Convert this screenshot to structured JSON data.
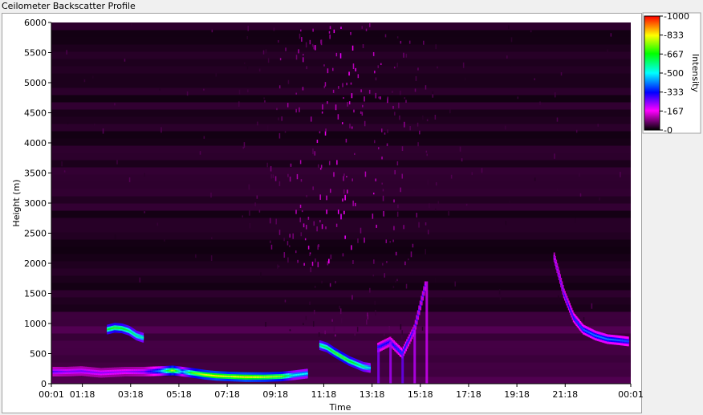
{
  "window": {
    "title": "Ceilometer Backscatter Profile"
  },
  "chart_data": {
    "type": "heatmap",
    "title": "",
    "xlabel": "Time",
    "ylabel": "Height (m)",
    "x_ticks": [
      "00:01",
      "01:18",
      "03:18",
      "05:18",
      "07:18",
      "09:18",
      "11:18",
      "13:18",
      "15:18",
      "17:18",
      "19:18",
      "21:18",
      "00:01"
    ],
    "x_tick_hours": [
      0.0,
      1.283,
      3.283,
      5.283,
      7.283,
      9.283,
      11.283,
      13.283,
      15.283,
      17.283,
      19.283,
      21.283,
      24.0
    ],
    "xlim_hours": [
      0,
      24
    ],
    "y_ticks": [
      0,
      500,
      1000,
      1500,
      2000,
      2500,
      3000,
      3500,
      4000,
      4500,
      5000,
      5500,
      6000
    ],
    "ylim": [
      0,
      6000
    ],
    "grid": false,
    "colorbar": {
      "label": "Intensity",
      "range": [
        0,
        1000
      ],
      "tick_labels": [
        "-1000",
        "-833",
        "-667",
        "-500",
        "-333",
        "-167",
        "-0"
      ],
      "tick_values": [
        1000,
        833,
        667,
        500,
        333,
        167,
        0
      ],
      "colors": [
        "#000000",
        "#ff00ff",
        "#0000ff",
        "#00ffff",
        "#00ff00",
        "#ffff00",
        "#ff0000"
      ],
      "color_stops": [
        0,
        0.17,
        0.33,
        0.5,
        0.67,
        0.83,
        1.0
      ]
    },
    "features": [
      {
        "name": "surface-layer",
        "t": [
          0.05,
          0.6,
          1.2,
          2.0,
          3.0,
          3.8,
          4.5,
          5.0,
          5.4,
          5.8,
          6.3,
          6.8,
          7.3,
          8.0,
          8.8,
          9.5,
          10.0,
          10.6
        ],
        "h": [
          200,
          200,
          210,
          180,
          200,
          200,
          210,
          220,
          200,
          180,
          150,
          130,
          120,
          110,
          110,
          120,
          140,
          170
        ],
        "intensity": [
          280,
          250,
          260,
          240,
          230,
          260,
          450,
          800,
          450,
          700,
          800,
          850,
          800,
          850,
          800,
          750,
          520,
          500
        ]
      },
      {
        "name": "morning-cloud",
        "t": [
          2.3,
          2.6,
          2.9,
          3.2,
          3.5,
          3.8
        ],
        "h": [
          900,
          930,
          920,
          880,
          800,
          760
        ],
        "intensity": [
          650,
          700,
          680,
          620,
          600,
          550
        ]
      },
      {
        "name": "midday-cloud",
        "t": [
          11.1,
          11.4,
          11.7,
          12.0,
          12.3,
          12.6,
          12.9,
          13.2
        ],
        "h": [
          640,
          600,
          520,
          450,
          380,
          330,
          280,
          260
        ],
        "intensity": [
          600,
          650,
          700,
          720,
          680,
          650,
          600,
          500
        ]
      },
      {
        "name": "afternoon-plumes",
        "t": [
          13.5,
          14.0,
          14.5,
          15.0,
          15.5
        ],
        "h": [
          600,
          700,
          500,
          900,
          1700
        ],
        "intensity": [
          350,
          320,
          380,
          300,
          280
        ]
      },
      {
        "name": "evening-layer",
        "t": [
          20.8,
          21.2,
          21.6,
          22.0,
          22.5,
          23.0,
          23.5,
          23.9
        ],
        "h": [
          2100,
          1500,
          1100,
          900,
          800,
          740,
          720,
          700
        ],
        "intensity": [
          250,
          300,
          350,
          400,
          420,
          420,
          400,
          380
        ]
      }
    ],
    "noise": {
      "height_range": [
        2000,
        6000
      ],
      "time_range": [
        8,
        16
      ],
      "peak_intensity": 190
    }
  }
}
